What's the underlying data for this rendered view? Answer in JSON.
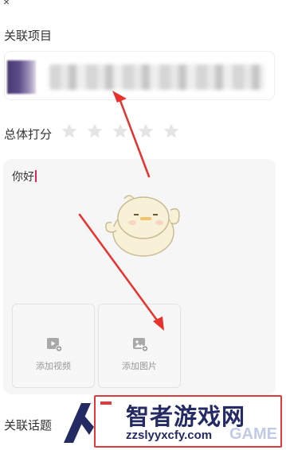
{
  "header": {
    "partial_glyph": "×"
  },
  "related_project": {
    "label": "关联项目",
    "card_content": "blurred-project-name"
  },
  "rating": {
    "label": "总体打分",
    "stars_total": 5,
    "stars_selected": 0,
    "star_color": "#e4e4e4"
  },
  "review": {
    "text": "你好",
    "caret_color": "#e0245e"
  },
  "uploads": {
    "video_label": "添加视频",
    "image_label": "添加图片"
  },
  "related_topic": {
    "label": "关联话题"
  },
  "annotations": {
    "arrow_color": "#e8322e"
  },
  "watermark": {
    "title": "智者游戏网",
    "url": "zzslyyxcfy.com",
    "faded_text": "GAME",
    "border_color": "#e23a3a",
    "text_color": "#242a63"
  }
}
